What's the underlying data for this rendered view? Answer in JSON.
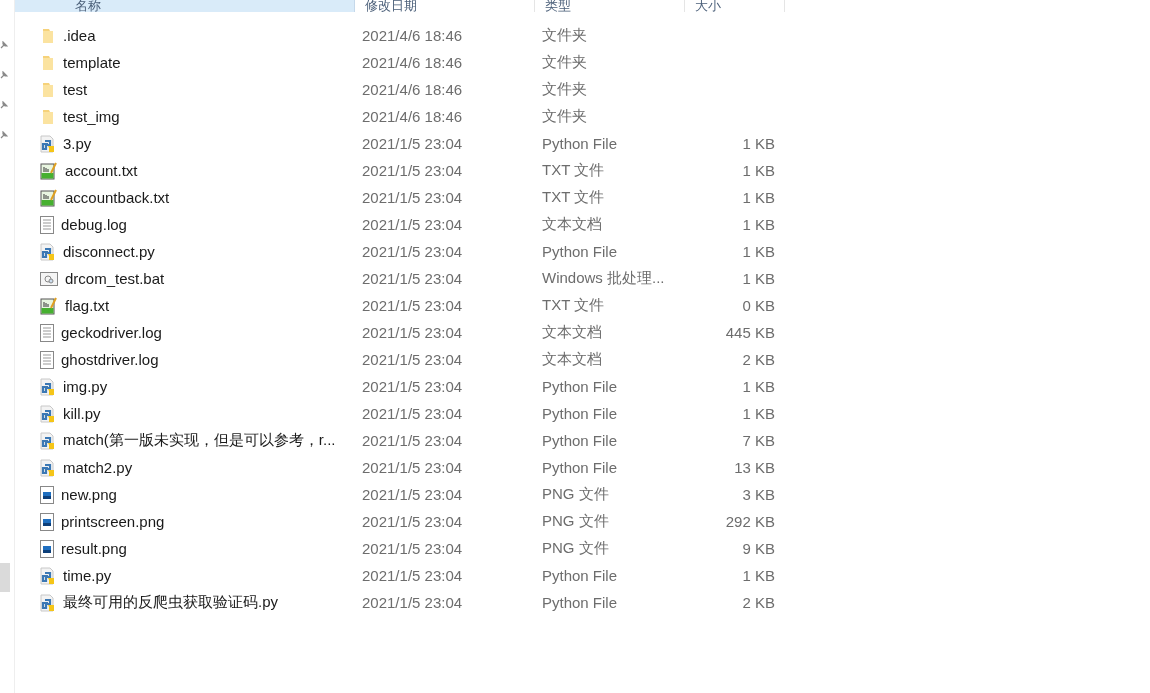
{
  "columns": [
    {
      "label": "名称",
      "selected": true
    },
    {
      "label": "修改日期",
      "selected": false
    },
    {
      "label": "类型",
      "selected": false
    },
    {
      "label": "大小",
      "selected": false
    }
  ],
  "files": [
    {
      "kind": "folder",
      "name": ".idea",
      "date": "2021/4/6 18:46",
      "type": "文件夹"
    },
    {
      "kind": "folder",
      "name": "template",
      "date": "2021/4/6 18:46",
      "type": "文件夹"
    },
    {
      "kind": "folder",
      "name": "test",
      "date": "2021/4/6 18:46",
      "type": "文件夹"
    },
    {
      "kind": "folder",
      "name": "test_img",
      "date": "2021/4/6 18:46",
      "type": "文件夹"
    },
    {
      "kind": "python",
      "name": "3.py",
      "date": "2021/1/5 23:04",
      "type": "Python File",
      "size": "1 KB"
    },
    {
      "kind": "txt",
      "name": "account.txt",
      "date": "2021/1/5 23:04",
      "type": "TXT 文件",
      "size": "1 KB"
    },
    {
      "kind": "txt",
      "name": "accountback.txt",
      "date": "2021/1/5 23:04",
      "type": "TXT 文件",
      "size": "1 KB"
    },
    {
      "kind": "log",
      "name": "debug.log",
      "date": "2021/1/5 23:04",
      "type": "文本文档",
      "size": "1 KB"
    },
    {
      "kind": "python",
      "name": "disconnect.py",
      "date": "2021/1/5 23:04",
      "type": "Python File",
      "size": "1 KB"
    },
    {
      "kind": "bat",
      "name": "drcom_test.bat",
      "date": "2021/1/5 23:04",
      "type": "Windows 批处理...",
      "size": "1 KB"
    },
    {
      "kind": "txt",
      "name": "flag.txt",
      "date": "2021/1/5 23:04",
      "type": "TXT 文件",
      "size": "0 KB"
    },
    {
      "kind": "log",
      "name": "geckodriver.log",
      "date": "2021/1/5 23:04",
      "type": "文本文档",
      "size": "445 KB"
    },
    {
      "kind": "log",
      "name": "ghostdriver.log",
      "date": "2021/1/5 23:04",
      "type": "文本文档",
      "size": "2 KB"
    },
    {
      "kind": "python",
      "name": "img.py",
      "date": "2021/1/5 23:04",
      "type": "Python File",
      "size": "1 KB"
    },
    {
      "kind": "python",
      "name": "kill.py",
      "date": "2021/1/5 23:04",
      "type": "Python File",
      "size": "1 KB"
    },
    {
      "kind": "python",
      "name": "match(第一版未实现，但是可以参考，r...",
      "date": "2021/1/5 23:04",
      "type": "Python File",
      "size": "7 KB"
    },
    {
      "kind": "python",
      "name": "match2.py",
      "date": "2021/1/5 23:04",
      "type": "Python File",
      "size": "13 KB"
    },
    {
      "kind": "png",
      "name": "new.png",
      "date": "2021/1/5 23:04",
      "type": "PNG 文件",
      "size": "3 KB"
    },
    {
      "kind": "png",
      "name": "printscreen.png",
      "date": "2021/1/5 23:04",
      "type": "PNG 文件",
      "size": "292 KB"
    },
    {
      "kind": "png",
      "name": "result.png",
      "date": "2021/1/5 23:04",
      "type": "PNG 文件",
      "size": "9 KB"
    },
    {
      "kind": "python",
      "name": "time.py",
      "date": "2021/1/5 23:04",
      "type": "Python File",
      "size": "1 KB"
    },
    {
      "kind": "python",
      "name": "最终可用的反爬虫获取验证码.py",
      "date": "2021/1/5 23:04",
      "type": "Python File",
      "size": "2 KB"
    }
  ]
}
